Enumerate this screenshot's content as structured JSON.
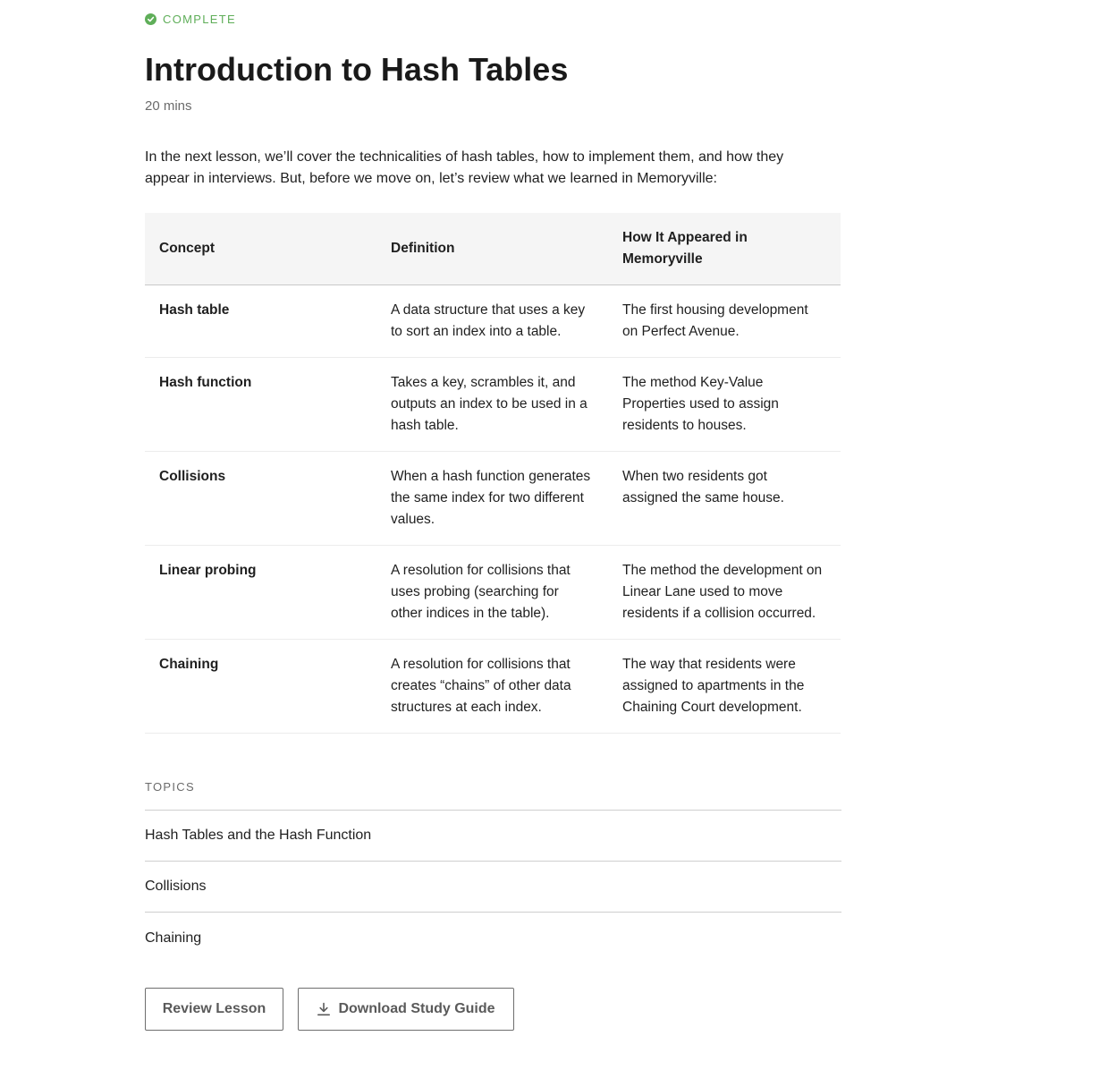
{
  "status": {
    "label": "COMPLETE",
    "color": "#5fae59",
    "icon": "check-circle-icon"
  },
  "lesson": {
    "title": "Introduction to Hash Tables",
    "duration": "20 mins",
    "intro": "In the next lesson, we’ll cover the technicalities of hash tables, how to implement them, and how they appear in interviews. But, before we move on, let’s review what we learned in Memoryville:"
  },
  "table": {
    "headers": [
      "Concept",
      "Definition",
      "How It Appeared in Memoryville"
    ],
    "rows": [
      {
        "concept": "Hash table",
        "definition": "A data structure that uses a key to sort an index into a table.",
        "appearance": "The first housing development on Perfect Avenue."
      },
      {
        "concept": "Hash function",
        "definition": "Takes a key, scrambles it, and outputs an index to be used in a hash table.",
        "appearance": "The method Key-Value Properties used to assign residents to houses."
      },
      {
        "concept": "Collisions",
        "definition": "When a hash function generates the same index for two different values.",
        "appearance": "When two residents got assigned the same house."
      },
      {
        "concept": "Linear probing",
        "definition": "A resolution for collisions that uses probing (searching for other indices in the table).",
        "appearance": "The method the development on Linear Lane used to move residents if a collision occurred."
      },
      {
        "concept": "Chaining",
        "definition": "A resolution for collisions that creates “chains” of other data structures at each index.",
        "appearance": "The way that residents were assigned to apartments in the Chaining Court development."
      }
    ]
  },
  "topics": {
    "label": "TOPICS",
    "items": [
      "Hash Tables and the Hash Function",
      "Collisions",
      "Chaining"
    ]
  },
  "actions": {
    "review_label": "Review Lesson",
    "download_label": "Download Study Guide",
    "download_icon": "download-icon"
  }
}
